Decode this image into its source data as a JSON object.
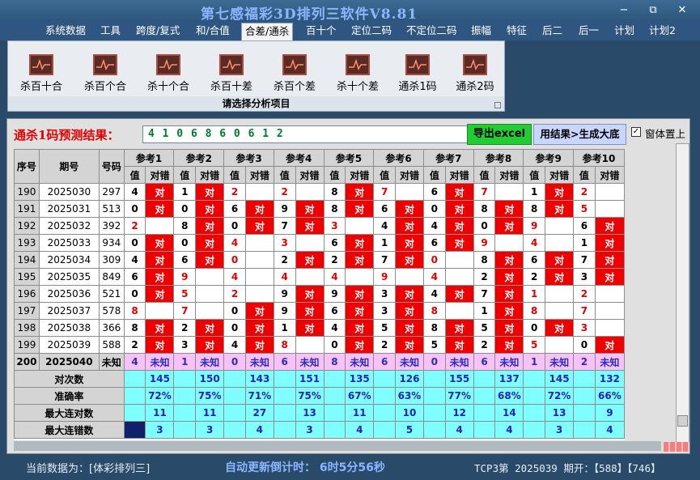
{
  "app": {
    "title": "第七感福彩3D排列三软件V8.81",
    "win_minimize": "−",
    "win_restore": "⧉",
    "win_close": "✕"
  },
  "menu": [
    "系统数据",
    "工具",
    "跨度/复式",
    "和/合值",
    "合差/通杀",
    "百十个",
    "定位二码",
    "不定位二码",
    "振幅",
    "特征",
    "后二",
    "后一",
    "计划",
    "计划2"
  ],
  "ribbon": {
    "buttons": [
      "杀百十合",
      "杀百个合",
      "杀十个合",
      "杀百十差",
      "杀百个差",
      "杀十个差",
      "通杀1码",
      "通杀2码"
    ],
    "caption": "请选择分析项目"
  },
  "prediction": {
    "label": "通杀1码预测结果：",
    "value": "4 1 0 6 8 6 0 6 1 2",
    "excel_button": "导出excel",
    "generate_button": "用结果>生成大底",
    "pin_checkbox": "✓",
    "pin_label": "窗体置上"
  },
  "table": {
    "headers": {
      "seq": "序号",
      "period": "期号",
      "number": "号码",
      "refs": [
        "参考1",
        "参考2",
        "参考3",
        "参考4",
        "参考5",
        "参考6",
        "参考7",
        "参考8",
        "参考9",
        "参考10"
      ],
      "value": "值",
      "result": "对错"
    },
    "rows": [
      {
        "seq": "190",
        "period": "2025030",
        "number": "297",
        "refs": [
          [
            "4",
            "对"
          ],
          [
            "1",
            "对"
          ],
          [
            "2",
            ""
          ],
          [
            "2",
            ""
          ],
          [
            "8",
            "对"
          ],
          [
            "7",
            ""
          ],
          [
            "6",
            "对"
          ],
          [
            "7",
            ""
          ],
          [
            "1",
            "对"
          ],
          [
            "2",
            ""
          ]
        ]
      },
      {
        "seq": "191",
        "period": "2025031",
        "number": "513",
        "refs": [
          [
            "0",
            "对"
          ],
          [
            "0",
            "对"
          ],
          [
            "6",
            "对"
          ],
          [
            "9",
            "对"
          ],
          [
            "8",
            "对"
          ],
          [
            "6",
            "对"
          ],
          [
            "0",
            "对"
          ],
          [
            "8",
            "对"
          ],
          [
            "8",
            "对"
          ],
          [
            "5",
            ""
          ]
        ]
      },
      {
        "seq": "192",
        "period": "2025032",
        "number": "392",
        "refs": [
          [
            "2",
            ""
          ],
          [
            "8",
            "对"
          ],
          [
            "0",
            "对"
          ],
          [
            "7",
            "对"
          ],
          [
            "3",
            ""
          ],
          [
            "4",
            "对"
          ],
          [
            "4",
            "对"
          ],
          [
            "0",
            "对"
          ],
          [
            "9",
            ""
          ],
          [
            "6",
            "对"
          ]
        ]
      },
      {
        "seq": "193",
        "period": "2025033",
        "number": "934",
        "refs": [
          [
            "0",
            "对"
          ],
          [
            "0",
            "对"
          ],
          [
            "4",
            ""
          ],
          [
            "3",
            ""
          ],
          [
            "6",
            "对"
          ],
          [
            "1",
            "对"
          ],
          [
            "6",
            "对"
          ],
          [
            "9",
            ""
          ],
          [
            "4",
            ""
          ],
          [
            "1",
            "对"
          ]
        ]
      },
      {
        "seq": "194",
        "period": "2025034",
        "number": "309",
        "refs": [
          [
            "4",
            "对"
          ],
          [
            "6",
            "对"
          ],
          [
            "0",
            ""
          ],
          [
            "2",
            "对"
          ],
          [
            "2",
            "对"
          ],
          [
            "7",
            "对"
          ],
          [
            "0",
            ""
          ],
          [
            "8",
            "对"
          ],
          [
            "6",
            "对"
          ],
          [
            "7",
            "对"
          ]
        ]
      },
      {
        "seq": "195",
        "period": "2025035",
        "number": "849",
        "refs": [
          [
            "6",
            "对"
          ],
          [
            "9",
            ""
          ],
          [
            "4",
            ""
          ],
          [
            "4",
            ""
          ],
          [
            "4",
            ""
          ],
          [
            "9",
            ""
          ],
          [
            "4",
            ""
          ],
          [
            "2",
            "对"
          ],
          [
            "2",
            "对"
          ],
          [
            "3",
            "对"
          ]
        ]
      },
      {
        "seq": "196",
        "period": "2025036",
        "number": "521",
        "refs": [
          [
            "0",
            "对"
          ],
          [
            "5",
            ""
          ],
          [
            "2",
            ""
          ],
          [
            "9",
            "对"
          ],
          [
            "9",
            "对"
          ],
          [
            "3",
            "对"
          ],
          [
            "4",
            "对"
          ],
          [
            "7",
            "对"
          ],
          [
            "1",
            ""
          ],
          [
            "2",
            ""
          ]
        ]
      },
      {
        "seq": "197",
        "period": "2025037",
        "number": "578",
        "refs": [
          [
            "8",
            ""
          ],
          [
            "7",
            ""
          ],
          [
            "0",
            "对"
          ],
          [
            "9",
            "对"
          ],
          [
            "6",
            "对"
          ],
          [
            "3",
            "对"
          ],
          [
            "8",
            ""
          ],
          [
            "1",
            "对"
          ],
          [
            "8",
            ""
          ],
          [
            "7",
            ""
          ]
        ]
      },
      {
        "seq": "198",
        "period": "2025038",
        "number": "366",
        "refs": [
          [
            "8",
            "对"
          ],
          [
            "2",
            "对"
          ],
          [
            "0",
            "对"
          ],
          [
            "1",
            "对"
          ],
          [
            "4",
            "对"
          ],
          [
            "5",
            "对"
          ],
          [
            "8",
            "对"
          ],
          [
            "5",
            "对"
          ],
          [
            "0",
            "对"
          ],
          [
            "3",
            ""
          ]
        ]
      },
      {
        "seq": "199",
        "period": "2025039",
        "number": "588",
        "refs": [
          [
            "2",
            "对"
          ],
          [
            "3",
            "对"
          ],
          [
            "4",
            "对"
          ],
          [
            "8",
            ""
          ],
          [
            "0",
            "对"
          ],
          [
            "2",
            "对"
          ],
          [
            "5",
            "对"
          ],
          [
            "2",
            "对"
          ],
          [
            "5",
            ""
          ],
          [
            "0",
            "对"
          ]
        ]
      }
    ],
    "unknown_row": {
      "seq": "200",
      "period": "2025040",
      "number": "未知",
      "values": [
        "4",
        "1",
        "0",
        "6",
        "8",
        "6",
        "0",
        "6",
        "1",
        "2"
      ],
      "result": "未知"
    },
    "stats": [
      {
        "name": "对次数",
        "values": [
          "145",
          "150",
          "143",
          "151",
          "135",
          "126",
          "155",
          "137",
          "145",
          "132"
        ]
      },
      {
        "name": "准确率",
        "values": [
          "72%",
          "75%",
          "71%",
          "75%",
          "67%",
          "63%",
          "77%",
          "68%",
          "72%",
          "66%"
        ]
      },
      {
        "name": "最大连对数",
        "values": [
          "11",
          "11",
          "27",
          "13",
          "11",
          "10",
          "12",
          "14",
          "13",
          "9"
        ]
      },
      {
        "name": "最大连错数",
        "values": [
          "3",
          "3",
          "4",
          "3",
          "4",
          "5",
          "4",
          "4",
          "3",
          "4"
        ]
      }
    ]
  },
  "status": {
    "current_data": "当前数据为：[体彩排列三]",
    "countdown": "自动更新倒计时： 6时5分56秒",
    "latest": "TCP3第 2025039 期开：【588】【746】"
  },
  "colors": {
    "hit": "#ee0000",
    "unknown_row": "#f7c2f7",
    "stats_bg": "#7fffff",
    "excel_btn": "#22cc33",
    "title_text": "#8ab6ff"
  }
}
